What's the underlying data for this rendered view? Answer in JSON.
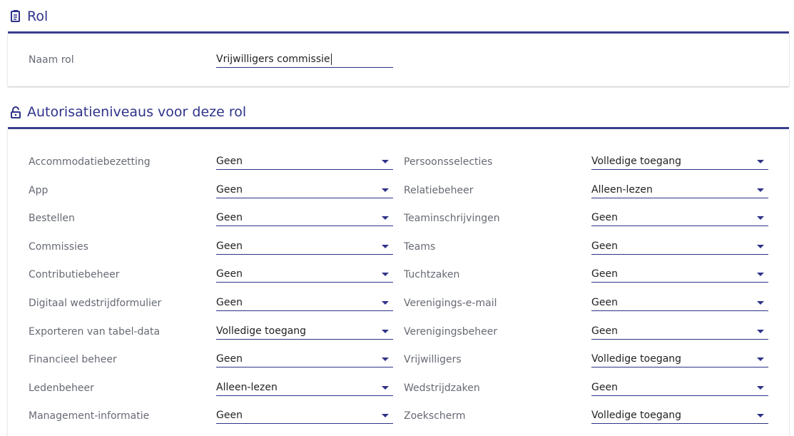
{
  "role_section": {
    "title": "Rol",
    "name_label": "Naam rol",
    "name_value": "Vrijwilligers commissie"
  },
  "auth_section": {
    "title": "Autorisatieniveaus voor deze rol",
    "left": [
      {
        "label": "Accommodatiebezetting",
        "value": "Geen"
      },
      {
        "label": "App",
        "value": "Geen"
      },
      {
        "label": "Bestellen",
        "value": "Geen"
      },
      {
        "label": "Commissies",
        "value": "Geen"
      },
      {
        "label": "Contributiebeheer",
        "value": "Geen"
      },
      {
        "label": "Digitaal wedstrijdformulier",
        "value": "Geen"
      },
      {
        "label": "Exporteren van tabel-data",
        "value": "Volledige toegang"
      },
      {
        "label": "Financieel beheer",
        "value": "Geen"
      },
      {
        "label": "Ledenbeheer",
        "value": "Alleen-lezen"
      },
      {
        "label": "Management-informatie",
        "value": "Geen"
      }
    ],
    "right": [
      {
        "label": "Persoonsselecties",
        "value": "Volledige toegang"
      },
      {
        "label": "Relatiebeheer",
        "value": "Alleen-lezen"
      },
      {
        "label": "Teaminschrijvingen",
        "value": "Geen"
      },
      {
        "label": "Teams",
        "value": "Geen"
      },
      {
        "label": "Tuchtzaken",
        "value": "Geen"
      },
      {
        "label": "Verenigings-e-mail",
        "value": "Geen"
      },
      {
        "label": "Verenigingsbeheer",
        "value": "Geen"
      },
      {
        "label": "Vrijwilligers",
        "value": "Volledige toegang"
      },
      {
        "label": "Wedstrijdzaken",
        "value": "Geen"
      },
      {
        "label": "Zoekscherm",
        "value": "Volledige toegang"
      }
    ]
  },
  "colors": {
    "accent": "#2e3389",
    "label": "#666a73"
  },
  "icons": {
    "role": "document-icon",
    "auth": "lock-icon"
  }
}
